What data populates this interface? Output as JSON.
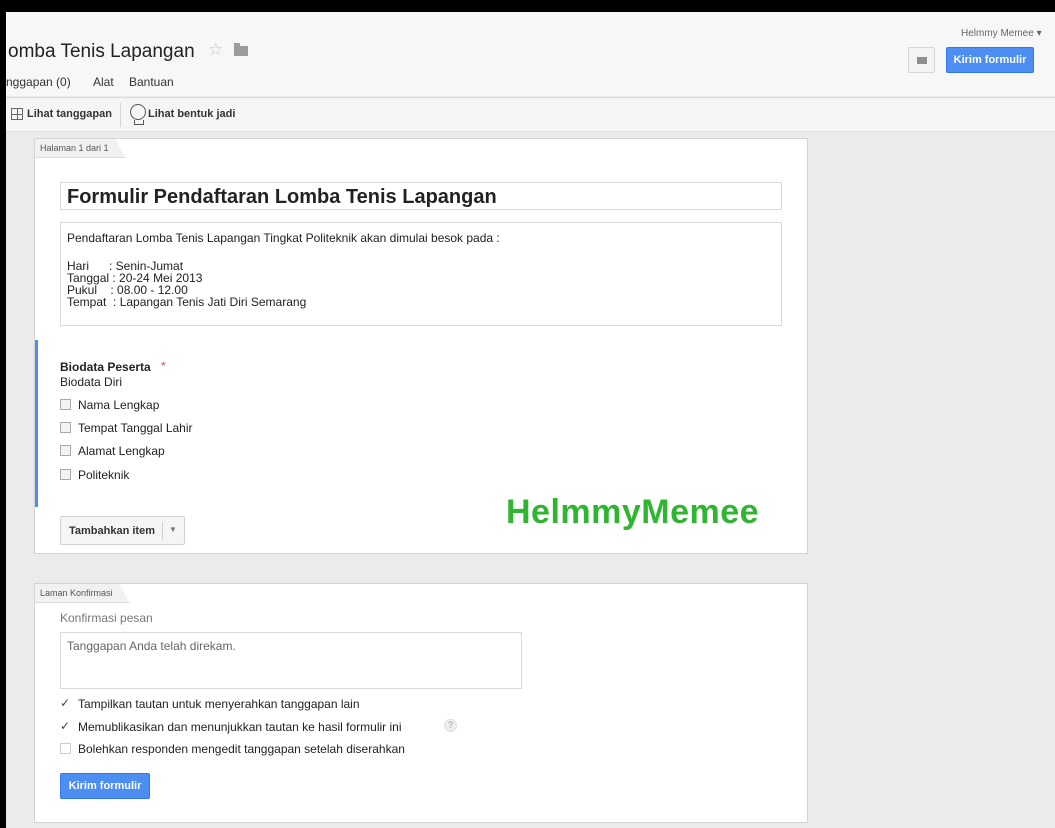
{
  "header": {
    "title": "omba Tenis Lapangan",
    "star_icon": "star-icon",
    "folder_icon": "folder-icon",
    "user_name": "Helmmy Memee ▾",
    "send_label": "Kirim formulir"
  },
  "menu": [
    "nggapan (0)",
    "Alat",
    "Bantuan"
  ],
  "toolbar": {
    "view_responses": "Lihat tanggapan",
    "view_live": "Lihat bentuk jadi"
  },
  "page1": {
    "tab_label": "Halaman 1 dari 1",
    "form_title": "Formulir Pendaftaran Lomba Tenis Lapangan",
    "description": {
      "intro": "Pendaftaran Lomba Tenis Lapangan Tingkat Politeknik akan dimulai besok pada :",
      "lines": [
        "Hari      : Senin-Jumat",
        "Tanggal : 20-24 Mei 2013",
        "Pukul    : 08.00 - 12.00",
        "Tempat  : Lapangan Tenis Jati Diri Semarang"
      ]
    },
    "question": {
      "title": "Biodata Peserta",
      "required_mark": "*",
      "help_text": "Biodata Diri",
      "options": [
        "Nama Lengkap",
        "Tempat Tanggal Lahir",
        "Alamat Lengkap",
        "Politeknik"
      ]
    },
    "add_item_label": "Tambahkan item",
    "watermark": "HelmmyMemee"
  },
  "page2": {
    "tab_label": "Laman Konfirmasi",
    "confirm_label": "Konfirmasi pesan",
    "confirm_text": "Tanggapan Anda telah direkam.",
    "options": [
      {
        "label": "Tampilkan tautan untuk menyerahkan tanggapan lain",
        "checked": true,
        "mark": "✓"
      },
      {
        "label": "Memublikasikan dan menunjukkan tautan ke hasil formulir ini",
        "checked": true,
        "mark": "✓"
      },
      {
        "label": "Bolehkan responden mengedit tanggapan setelah diserahkan",
        "checked": false,
        "mark": ""
      }
    ],
    "help_mark": "?",
    "send_label": "Kirim formulir"
  },
  "colors": {
    "accent": "#4d8ef2",
    "watermark": "#2fb52f",
    "required": "#dd4b39"
  }
}
